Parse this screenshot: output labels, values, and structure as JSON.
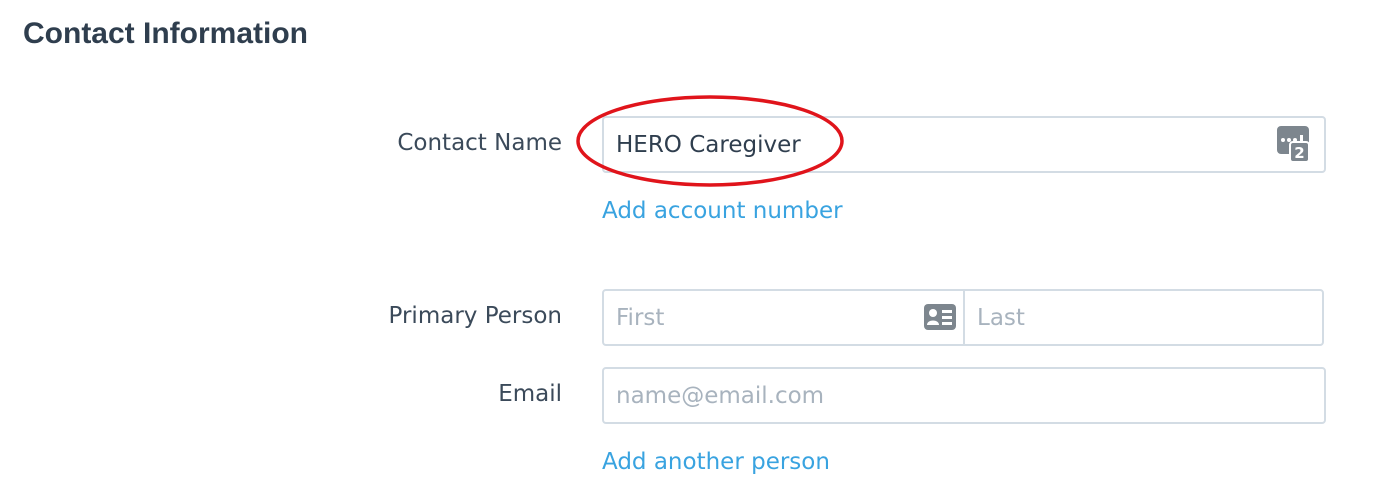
{
  "section": {
    "title": "Contact Information"
  },
  "contact_name": {
    "label": "Contact Name",
    "value": "HERO Caregiver",
    "account_icon": "account-number-icon",
    "add_account_link": "Add account number"
  },
  "primary_person": {
    "label": "Primary Person",
    "first_placeholder": "First",
    "last_placeholder": "Last",
    "card_icon": "contact-card-icon"
  },
  "email": {
    "label": "Email",
    "placeholder": "name@email.com",
    "add_person_link": "Add another person"
  },
  "colors": {
    "link": "#39a3e0",
    "highlight": "#e0141b",
    "border": "#d3dce4",
    "icon": "#7d868e"
  }
}
